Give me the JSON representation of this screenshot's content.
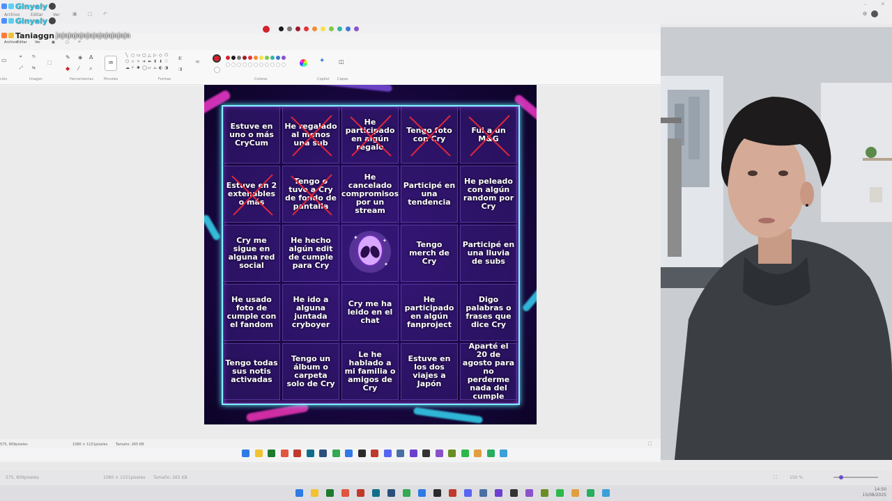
{
  "chat": [
    {
      "user": "Ginyely",
      "message": ""
    },
    {
      "user": "Ginyely",
      "message": ""
    },
    {
      "user": "Taniaggn",
      "message": "jajajajajajajajajajajaja"
    }
  ],
  "bingo": [
    [
      "Estuve en uno o más CryCum",
      "He regalado al menos una sub",
      "He participado en algún regalo",
      "Tengo foto con Cry",
      "Fui a un M&G"
    ],
    [
      "Estuve en 2 extenables o más",
      "Tengo o tuve a Cry de fondo de pantalla",
      "He cancelado compromisos por un stream",
      "Participé en una tendencia",
      "He peleado con algún random por Cry"
    ],
    [
      "Cry me sigue en alguna red social",
      "He hecho algún edit de cumple para Cry",
      "",
      "Tengo merch de Cry",
      "Participé en una lluvia de subs"
    ],
    [
      "He usado foto de cumple con el fandom",
      "He ido a alguna juntada cryboyer",
      "Cry me ha leido en el chat",
      "He participado en algún fanproject",
      "Digo palabras o frases que dice Cry"
    ],
    [
      "Tengo todas sus notis activadas",
      "Tengo un álbum o carpeta solo de Cry",
      "Le he hablado a mi familia o amigos de Cry",
      "Estuve en los dos viajes a Japón",
      "Aparté el 20 de agosto para no perderme nada del cumple"
    ]
  ],
  "crossed": [
    [
      0,
      1
    ],
    [
      0,
      2
    ],
    [
      0,
      3
    ],
    [
      0,
      4
    ],
    [
      1,
      0
    ],
    [
      1,
      1
    ]
  ],
  "center_icon": "alien-icon",
  "palette": [
    "#d4222c",
    "#1a1a1a",
    "#7a7a7a",
    "#9b1c2e",
    "#e0353b",
    "#f28d2c",
    "#f7e14a",
    "#7fc94a",
    "#33b5a7",
    "#3d78d8",
    "#8a52c8"
  ],
  "inner_menu": {
    "file": "Archivo",
    "edit": "Editar",
    "view": "Ver"
  },
  "outer_menu": {
    "file": "Archivo",
    "edit": "Editar",
    "view": "Ver"
  },
  "ribbon_groups": {
    "image": "Imagen",
    "tools": "Herramientas",
    "brushes": "Pinceles",
    "shapes": "Formas",
    "colors": "Colores",
    "copilot": "Copilot",
    "layers": "Capas"
  },
  "inner_status": {
    "cursor": "575, 809píxeles",
    "size": "1080 × 1151píxeles",
    "filesize": "Tamaño: 265 KB"
  },
  "outer_status": {
    "cursor": "575, 809píxeles",
    "size": "1080 × 1151píxeles",
    "filesize": "Tamaño: 265 KB",
    "zoom": "150 %"
  },
  "clock": {
    "time": "14:50",
    "date": "15/08/2025"
  }
}
